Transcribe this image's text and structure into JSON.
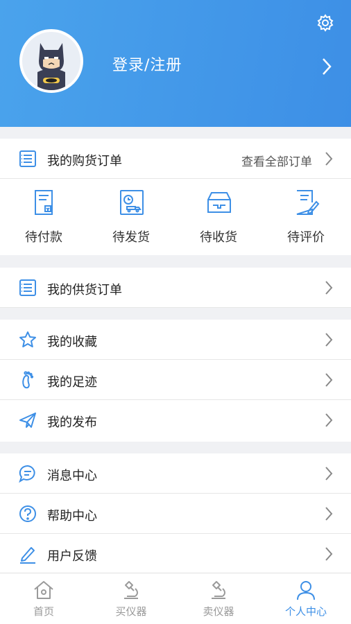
{
  "header": {
    "login_label": "登录/注册",
    "settings_icon": "gear-icon",
    "avatar_icon": "batman-avatar"
  },
  "purchase_orders": {
    "label": "我的购货订单",
    "view_all": "查看全部订单",
    "tiles": [
      {
        "label": "待付款",
        "icon": "pending-payment-icon"
      },
      {
        "label": "待发货",
        "icon": "pending-shipment-icon"
      },
      {
        "label": "待收货",
        "icon": "pending-receipt-icon"
      },
      {
        "label": "待评价",
        "icon": "pending-review-icon"
      }
    ]
  },
  "supply_orders": {
    "label": "我的供货订单"
  },
  "personal": {
    "items": [
      {
        "label": "我的收藏",
        "icon": "star-icon"
      },
      {
        "label": "我的足迹",
        "icon": "footprint-icon"
      },
      {
        "label": "我的发布",
        "icon": "paper-plane-icon"
      }
    ]
  },
  "support": {
    "items": [
      {
        "label": "消息中心",
        "icon": "message-icon"
      },
      {
        "label": "帮助中心",
        "icon": "help-icon"
      },
      {
        "label": "用户反馈",
        "icon": "pen-icon"
      }
    ]
  },
  "tabbar": {
    "tabs": [
      {
        "label": "首页",
        "icon": "home-icon",
        "active": false
      },
      {
        "label": "买仪器",
        "icon": "microscope-icon",
        "active": false
      },
      {
        "label": "卖仪器",
        "icon": "microscope-sell-icon",
        "active": false
      },
      {
        "label": "个人中心",
        "icon": "person-icon",
        "active": true
      }
    ]
  },
  "colors": {
    "accent": "#3d8fe6",
    "header_start": "#4aa3ec",
    "icon": "#3d8fe6"
  }
}
